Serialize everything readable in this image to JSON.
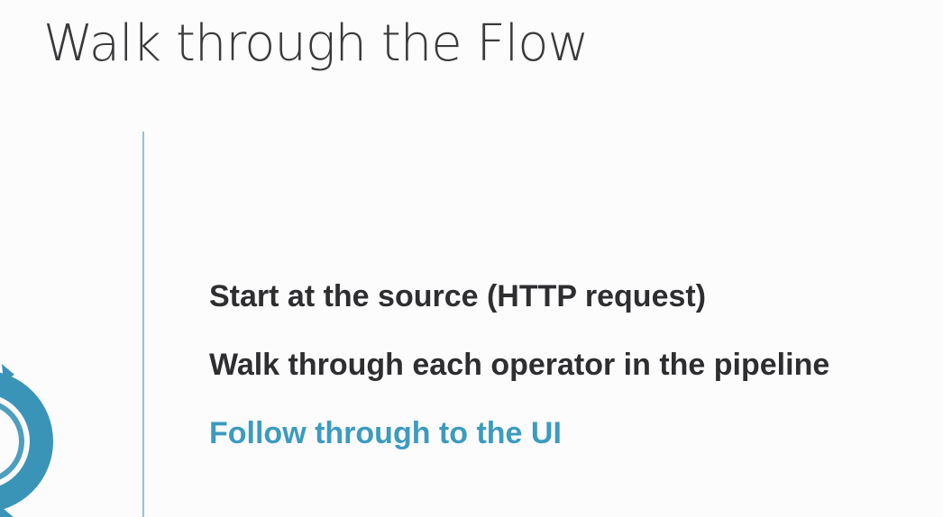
{
  "slide": {
    "title": "Walk through the Flow",
    "bullets": [
      {
        "text": "Start at the source (HTTP request)",
        "highlighted": false
      },
      {
        "text": "Walk through each operator in the pipeline",
        "highlighted": false
      },
      {
        "text": "Follow through to the UI",
        "highlighted": true
      }
    ]
  },
  "colors": {
    "background": "#fdfcfd",
    "title": "#3a3a3d",
    "bullet_text": "#2e2e31",
    "highlight": "#3c9bbf",
    "divider": "#8ec6d8",
    "logo": "#3a94b8"
  },
  "icons": {
    "logo": "partial-circular-logo-icon"
  }
}
